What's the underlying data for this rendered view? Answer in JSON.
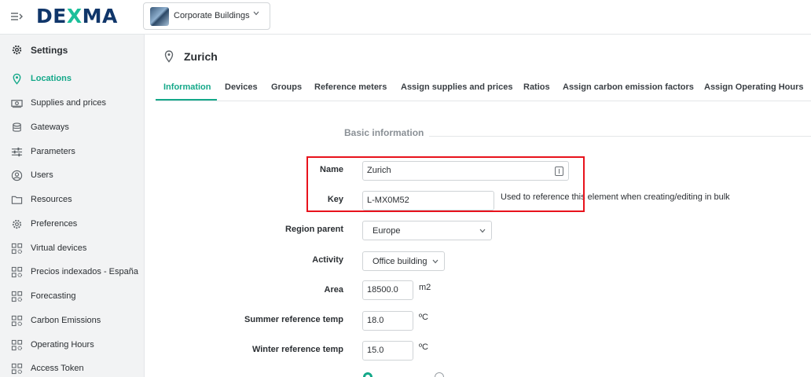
{
  "topbar": {
    "logo": {
      "prefix": "DE",
      "x": "X",
      "suffix": "MA"
    },
    "building_selector": {
      "label": "Corporate Buildings"
    }
  },
  "sidebar": {
    "items": [
      {
        "label": "Settings",
        "icon": "gear-icon"
      },
      {
        "label": "Locations",
        "icon": "location-pin-icon"
      },
      {
        "label": "Supplies and prices",
        "icon": "money-icon"
      },
      {
        "label": "Gateways",
        "icon": "gateway-icon"
      },
      {
        "label": "Parameters",
        "icon": "sliders-icon"
      },
      {
        "label": "Users",
        "icon": "user-icon"
      },
      {
        "label": "Resources",
        "icon": "folder-icon"
      },
      {
        "label": "Preferences",
        "icon": "gear-icon"
      },
      {
        "label": "Virtual devices",
        "icon": "grid-gear-icon"
      },
      {
        "label": "Precios indexados - España",
        "icon": "grid-gear-icon"
      },
      {
        "label": "Forecasting",
        "icon": "grid-gear-icon"
      },
      {
        "label": "Carbon Emissions",
        "icon": "grid-gear-icon"
      },
      {
        "label": "Operating Hours",
        "icon": "grid-gear-icon"
      },
      {
        "label": "Access Token",
        "icon": "grid-gear-icon"
      }
    ]
  },
  "location": {
    "title": "Zurich"
  },
  "tabs": [
    "Information",
    "Devices",
    "Groups",
    "Reference meters",
    "Assign supplies and prices",
    "Ratios",
    "Assign carbon emission factors",
    "Assign Operating Hours"
  ],
  "form": {
    "section_title": "Basic information",
    "name": {
      "label": "Name",
      "value": "Zurich"
    },
    "key": {
      "label": "Key",
      "value": "L-MX0M52",
      "helper": "Used to reference this element when creating/editing in bulk"
    },
    "region": {
      "label": "Region parent",
      "value": "Europe"
    },
    "activity": {
      "label": "Activity",
      "value": "Office building"
    },
    "area": {
      "label": "Area",
      "value": "18500.0",
      "unit": "m2"
    },
    "summer": {
      "label": "Summer reference temp",
      "value": "18.0",
      "unit": "ºC"
    },
    "winter": {
      "label": "Winter reference temp",
      "value": "15.0",
      "unit": "ºC"
    }
  },
  "colors": {
    "accent": "#14a889",
    "brand": "#10366a",
    "highlight": "#e8121c"
  }
}
